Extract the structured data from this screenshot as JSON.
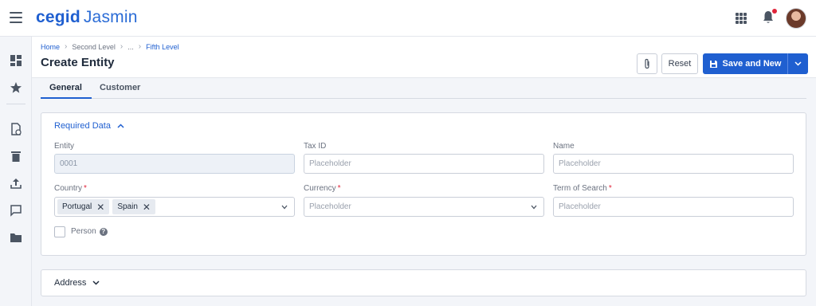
{
  "app": {
    "brand_company": "cegid",
    "brand_product": "Jasmin"
  },
  "breadcrumb": {
    "items": [
      "Home",
      "Second Level",
      "...",
      "Fifth Level"
    ]
  },
  "page": {
    "title": "Create Entity"
  },
  "toolbar": {
    "reset_label": "Reset",
    "save_label": "Save and New"
  },
  "tabs": [
    {
      "label": "General",
      "active": true
    },
    {
      "label": "Customer",
      "active": false
    }
  ],
  "required_section": {
    "title": "Required Data",
    "expanded": true,
    "fields": {
      "entity": {
        "label": "Entity",
        "value": "0001"
      },
      "tax_id": {
        "label": "Tax ID",
        "placeholder": "Placeholder"
      },
      "name": {
        "label": "Name",
        "placeholder": "Placeholder"
      },
      "country": {
        "label": "Country",
        "required_mark": "*",
        "chips": [
          "Portugal",
          "Spain"
        ]
      },
      "currency": {
        "label": "Currency",
        "required_mark": "*",
        "placeholder": "Placeholder"
      },
      "term_of_search": {
        "label": "Term of Search",
        "required_mark": "*",
        "placeholder": "Placeholder"
      },
      "person": {
        "label": "Person",
        "checked": false
      }
    }
  },
  "address_section": {
    "title": "Address",
    "expanded": false
  },
  "colors": {
    "accent": "#1f5fd0",
    "required": "#e0243a",
    "notification_dot": "#e0243a"
  },
  "icons": [
    "menu-icon",
    "apps-grid-icon",
    "bell-icon",
    "dashboard-icon",
    "star-icon",
    "document-icon",
    "trash-icon",
    "upload-icon",
    "chat-icon",
    "folder-icon",
    "paperclip-icon",
    "save-icon",
    "chevron-down-icon",
    "chevron-up-icon",
    "close-icon",
    "help-icon"
  ]
}
